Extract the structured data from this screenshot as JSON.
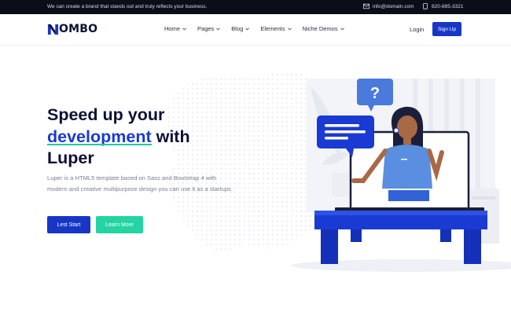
{
  "topbar": {
    "tagline": "We can create a brand that stands out and truly reflects your business.",
    "email": "info@domain.com",
    "phone": "820-885-3321",
    "email_icon": "envelope-icon",
    "phone_icon": "phone-icon"
  },
  "header": {
    "logo_text": "OMBO",
    "nav": [
      {
        "label": "Home"
      },
      {
        "label": "Pages"
      },
      {
        "label": "Blog"
      },
      {
        "label": "Elements"
      },
      {
        "label": "Niche Demos"
      }
    ],
    "login_label": "Login",
    "signup_label": "Sign Up"
  },
  "hero": {
    "headline_line1": "Speed up your",
    "headline_accent": "development",
    "headline_mid": " with",
    "headline_line3": "Luper",
    "description": "Luper is a HTML5 template based on Sass and Bootstrap 4 with modern and creative multipurpose design you can use it as a startups.",
    "primary_button": "Lest Start",
    "secondary_button": "Learn More",
    "question_mark": "?"
  },
  "colors": {
    "brand_blue": "#1736c6",
    "accent_green": "#24d4a2",
    "dark": "#0d1033",
    "topbar_bg": "#0b0d17"
  }
}
